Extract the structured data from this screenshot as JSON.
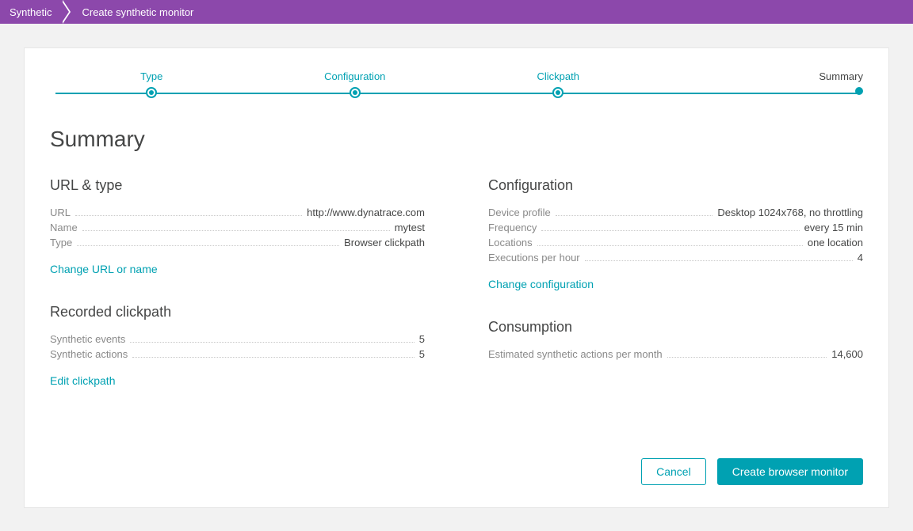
{
  "breadcrumb": {
    "root": "Synthetic",
    "current": "Create synthetic monitor"
  },
  "stepper": {
    "steps": [
      "Type",
      "Configuration",
      "Clickpath",
      "Summary"
    ],
    "active_index": 3
  },
  "page_title": "Summary",
  "url_type": {
    "title": "URL & type",
    "rows": [
      {
        "label": "URL",
        "value": "http://www.dynatrace.com"
      },
      {
        "label": "Name",
        "value": "mytest"
      },
      {
        "label": "Type",
        "value": "Browser clickpath"
      }
    ],
    "action": "Change URL or name"
  },
  "configuration": {
    "title": "Configuration",
    "rows": [
      {
        "label": "Device profile",
        "value": "Desktop 1024x768, no throttling"
      },
      {
        "label": "Frequency",
        "value": "every 15 min"
      },
      {
        "label": "Locations",
        "value": "one location"
      },
      {
        "label": "Executions per hour",
        "value": "4"
      }
    ],
    "action": "Change configuration"
  },
  "clickpath": {
    "title": "Recorded clickpath",
    "rows": [
      {
        "label": "Synthetic events",
        "value": "5"
      },
      {
        "label": "Synthetic actions",
        "value": "5"
      }
    ],
    "action": "Edit clickpath"
  },
  "consumption": {
    "title": "Consumption",
    "rows": [
      {
        "label": "Estimated synthetic actions per month",
        "value": "14,600"
      }
    ]
  },
  "buttons": {
    "cancel": "Cancel",
    "create": "Create browser monitor"
  }
}
